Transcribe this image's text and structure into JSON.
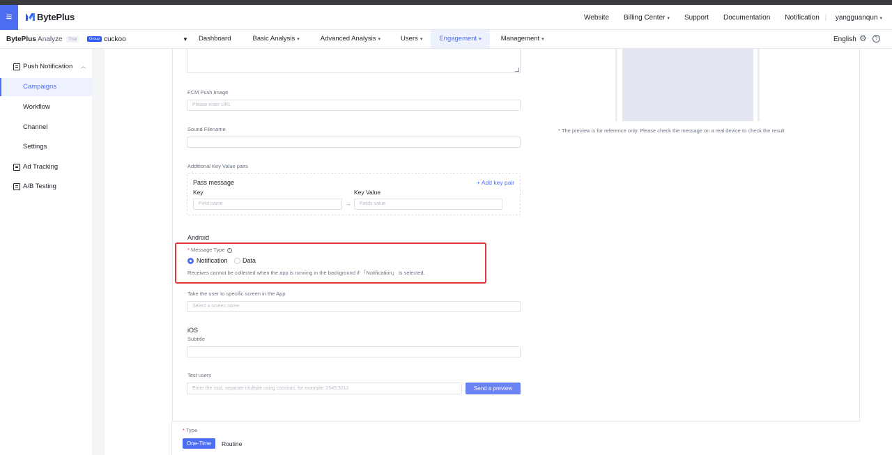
{
  "topbar": {
    "brand": "BytePlus",
    "nav": [
      {
        "label": "Website",
        "has_caret": false
      },
      {
        "label": "Billing Center",
        "has_caret": true
      },
      {
        "label": "Support",
        "has_caret": false
      },
      {
        "label": "Documentation",
        "has_caret": false
      },
      {
        "label": "Notification",
        "has_caret": false
      },
      {
        "label": "yangguanqun",
        "has_caret": true
      }
    ]
  },
  "subbar": {
    "product_bold": "BytePlus",
    "product_light": " Analyze",
    "trial_badge": "Trial",
    "group_badge": "Group",
    "project": "cuckoo",
    "tabs": [
      {
        "label": "Dashboard",
        "has_caret": false
      },
      {
        "label": "Basic Analysis",
        "has_caret": true
      },
      {
        "label": "Advanced Analysis",
        "has_caret": true
      },
      {
        "label": "Users",
        "has_caret": true
      },
      {
        "label": "Engagement",
        "has_caret": true,
        "active": true
      },
      {
        "label": "Management",
        "has_caret": true
      }
    ],
    "language": "English"
  },
  "sidebar": {
    "items": [
      {
        "label": "Push Notification",
        "icon": "report-icon",
        "expanded": true
      },
      {
        "label": "Campaigns",
        "active": true
      },
      {
        "label": "Workflow"
      },
      {
        "label": "Channel"
      },
      {
        "label": "Settings"
      },
      {
        "label": "Ad Tracking",
        "icon": "report-icon"
      },
      {
        "label": "A/B Testing",
        "icon": "report-icon"
      }
    ]
  },
  "form": {
    "fcm_image_label": "FCM Push Image",
    "fcm_image_placeholder": "Please enter URL",
    "sound_label": "Sound Filename",
    "sound_value": "",
    "kv_label": "Additional Key Value pairs",
    "kv_title": "Pass message",
    "add_pair": "+ Add key pair",
    "key_col": "Key",
    "value_col": "Key Value",
    "key_placeholder": "Field name",
    "value_placeholder": "Fields value",
    "android_title": "Android",
    "message_type_label": "Message Type",
    "message_type_required": "*",
    "message_type_options": [
      "Notification",
      "Data"
    ],
    "message_type_selected": "Notification",
    "message_type_hint": "Receives cannot be collected when the app is running in the background if 「Notification」 is selected.",
    "screen_label": "Take the user to specific screen in the App",
    "screen_placeholder": "Select a screen name",
    "ios_title": "iOS",
    "subtitle_label": "Subtitle",
    "subtitle_value": "",
    "test_users_label": "Test users",
    "test_users_placeholder": "Enter the ssid, separate multiple using commas, for example: 2545,3212",
    "send_preview": "Send a preview",
    "type_label": "Type",
    "type_options": [
      "One-Time",
      "Routine"
    ],
    "type_selected": "One-Time"
  },
  "preview": {
    "note": "* The preview is for reference only. Please check the message on a real device to check the result"
  },
  "colors": {
    "accent": "#4e6ef2",
    "highlight_border": "#e03a3a"
  }
}
